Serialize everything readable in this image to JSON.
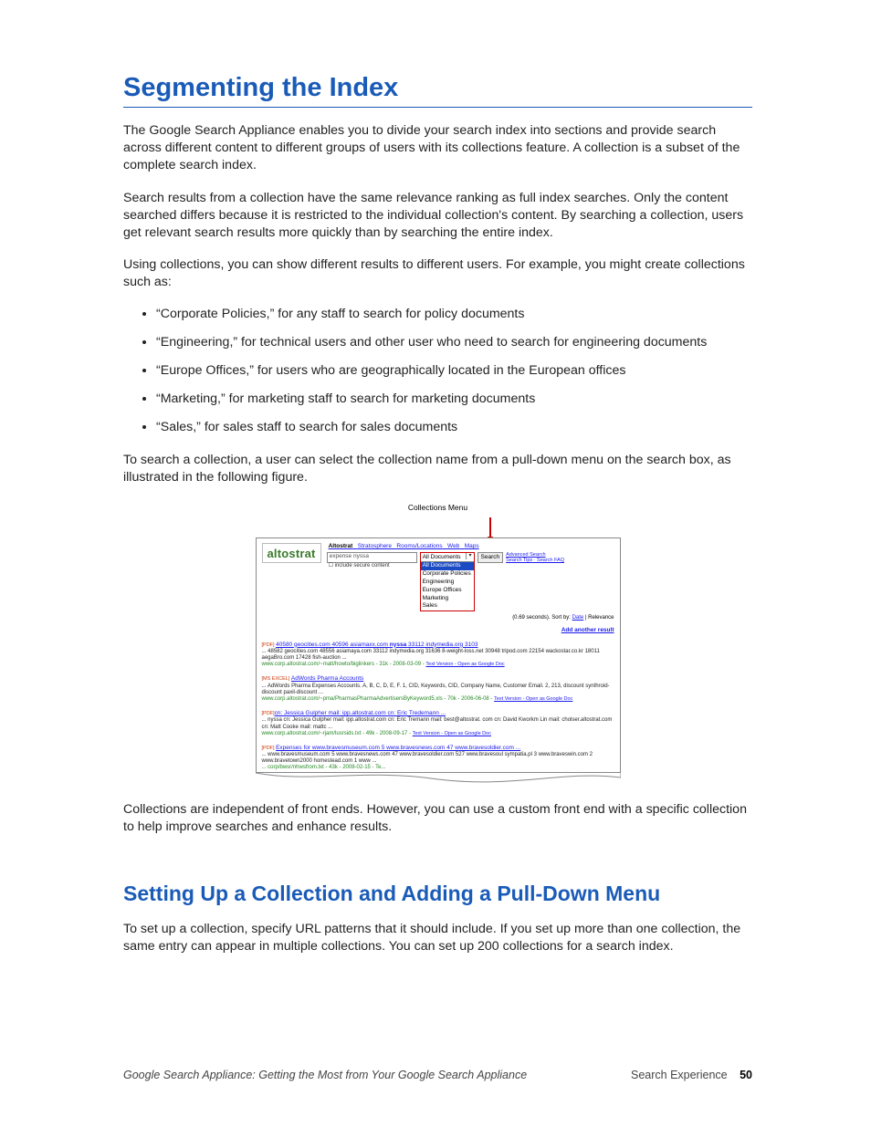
{
  "h1": "Segmenting the Index",
  "p1": "The Google Search Appliance enables you to divide your search index into sections and provide search across different content to different groups of users with its collections feature. A collection is a subset of the complete search index.",
  "p2": "Search results from a collection have the same relevance ranking as full index searches. Only the content searched differs because it is restricted to the individual collection's content. By searching a collection, users get relevant search results more quickly than by searching the entire index.",
  "p3": "Using collections, you can show different results to different users. For example, you might create collections such as:",
  "bullets": [
    "“Corporate Policies,” for any staff to search for policy documents",
    "“Engineering,” for technical users and other user who need to search for engineering documents",
    "“Europe Offices,” for users who are geographically located in the European offices",
    "“Marketing,” for marketing staff to search for marketing documents",
    "“Sales,” for sales staff to search for sales documents"
  ],
  "p4": "To search a collection, a user can select the collection name from a pull-down menu on the search box, as illustrated in the following figure.",
  "p5": "Collections are independent of front ends. However, you can use a custom front end with a specific collection to help improve searches and enhance results.",
  "h2": "Setting Up a Collection and Adding a Pull-Down Menu",
  "p6": "To set up a collection, specify URL patterns that it should include. If you set up more than one collection, the same entry can appear in multiple collections. You can set up 200 collections for a search index.",
  "figure": {
    "callout": "Collections Menu",
    "logo": "altostrat",
    "nav_bold": "Altostrat",
    "nav_links": [
      "Stratosphere",
      "Rooms/Locations",
      "Web",
      "Maps"
    ],
    "search_value": "expense nyssa",
    "secure_label": "include secure content",
    "dropdown_header": "All Documents",
    "dropdown_selected": "All Documents",
    "dropdown_items": [
      "Corporate Policies",
      "Engineering",
      "Europe Offices",
      "Marketing",
      "Sales"
    ],
    "search_btn": "Search",
    "adv1": "Advanced Search",
    "adv2": "Search Tips",
    "adv3": "Search FAQ",
    "stats": "(0.69 seconds). Sort by: ",
    "sort1": "Date",
    "sort2": " | Relevance",
    "add_result": "Add another result",
    "r1_tag": "[PDF] ",
    "r1_title_a": "40580 geocities.com 40596 asiamaxx.com ",
    "r1_title_b": "nyssa",
    "r1_title_c": "  33112 indymedia.org 3103",
    "r1_snip": "... 48582 geocities.com 48556 asiamaya.com 33112 indymedia.org 31636 8-weight-loss.net 30948 tripod.com 22154 wackostar.co.kr 18011 aegaBro.com 17428 fish-auction ...",
    "r1_url": "www.corp.altostrat.com/~matt/howto/biglinkers - 31k - 2008-03-09 - ",
    "r1_lk": "Text Version - Open as Google Doc",
    "r2_tag": "[MS EXCEL] ",
    "r2_title": "AdWords Pharma Accounts",
    "r2_snip": "... AdWords Pharma Expenses Accounts. A, B, C, D, E, F. 1, CID, Keywords, CID, Company Name, Customer Email. 2, 213, discount synthroid-discount paxil-discount ...",
    "r2_url": "www.corp.altostrat.com/~pma/PharmasPharmaAdvertisersByKeyword5.xls - 70k - 2006-06-08 - ",
    "r2_lk": "Text Version - Open as Google Doc",
    "r3_tag": "[PDF]",
    "r3_title": "cn: Jessica Gulpher mail: ipp.altostrat.com cn: Eric Tredemann ...",
    "r3_snip": "... nyssa cn: Jessica Gulpher mail: ipp.altostrat.com cn: Eric Tremann mail: best@altostrat. com cn: David Kworkm Lin mail: cholser.altostrat.com cn: Matt Cooke mail: mattc ...",
    "r3_url": "www.corp.altostrat.com/~rjam/lusrsids.txt - 49k - 2008-09-17 - ",
    "r3_lk": "Text Version - Open as Google Doc",
    "r4_tag": "[PDF] ",
    "r4_title": "Expenses for www.bravesmuseum.com 5 www.bravesnews.com 47 www.bravesoldier.com ...",
    "r4_snip": "... www.bravesmuseum.com 5 www.bravesnews.com 47 www.bravesoldier.com 527 www.bravesoul sympatia.pl 3 www.braveswin.com 2 www.bravetown2000 homestead.com 1 www ...",
    "r4_url": "... corp/bwsr/nhwsfrom.txt - 43k - 2008-02-15 - Te..."
  },
  "footer": {
    "docTitle": "Google Search Appliance: Getting the Most from Your Google Search Appliance",
    "section": "Search Experience",
    "page": "50"
  }
}
